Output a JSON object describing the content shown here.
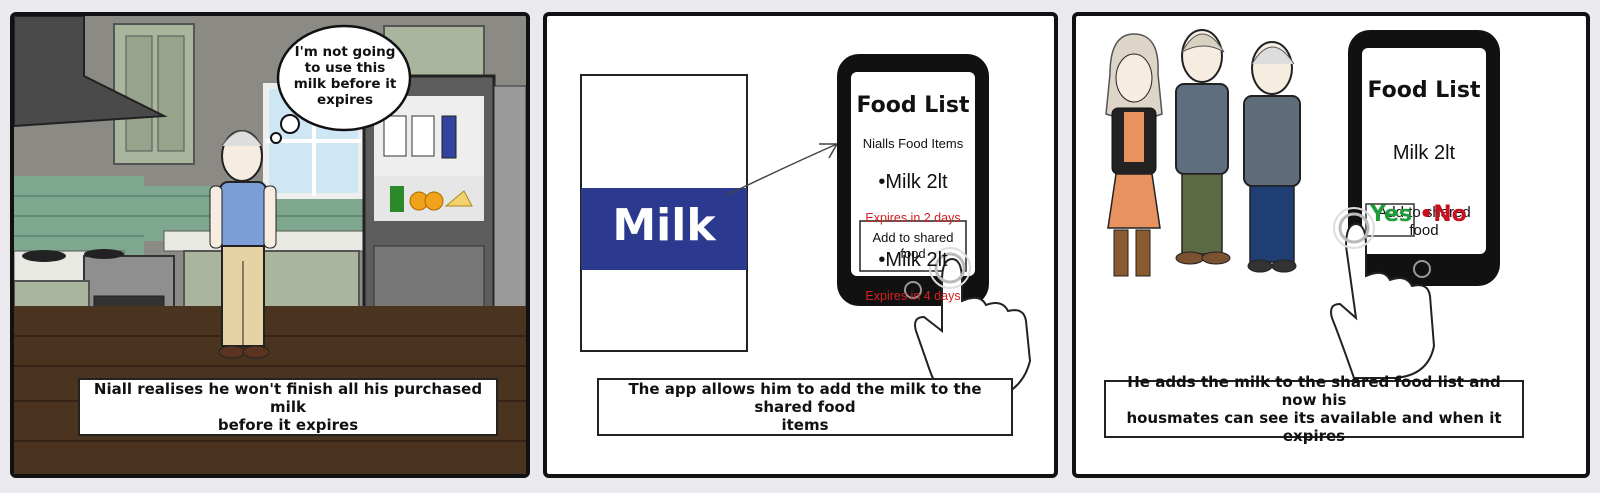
{
  "panels": [
    {
      "speech_bubble": "I'm not going\nto use this\nmilk before it\nexpires",
      "caption": "Niall realises he won't finish all his purchased milk\nbefore it expires"
    },
    {
      "milk_carton_label": "Milk",
      "phone": {
        "title": "Food List",
        "subtitle": "Nialls Food Items",
        "items": [
          {
            "name": "•Milk 2lt",
            "expiry": "Expires in 2 days"
          },
          {
            "name": "•Milk 2lt",
            "expiry": "Expires in 4 days"
          }
        ],
        "button_label": "Add to shared\nfood"
      },
      "caption": "The app allows him to add the milk to the shared food\nitems"
    },
    {
      "phone": {
        "title": "Food List",
        "item": "Milk 2lt",
        "prompt": "Add to shared\nfood",
        "yes_label": "Yes",
        "no_label": "•No"
      },
      "caption": "He adds the milk to the shared food list and now his\nhousmates can see its available and when it expires"
    }
  ],
  "colors": {
    "carton_blue": "#2b3a8f",
    "expiry_red": "#d42020",
    "yes_green": "#1e9e3a",
    "no_red": "#c8101e",
    "kitchen_wall": "#8a8a84",
    "tiles": "#7fa68f",
    "floor": "#4a3420"
  }
}
